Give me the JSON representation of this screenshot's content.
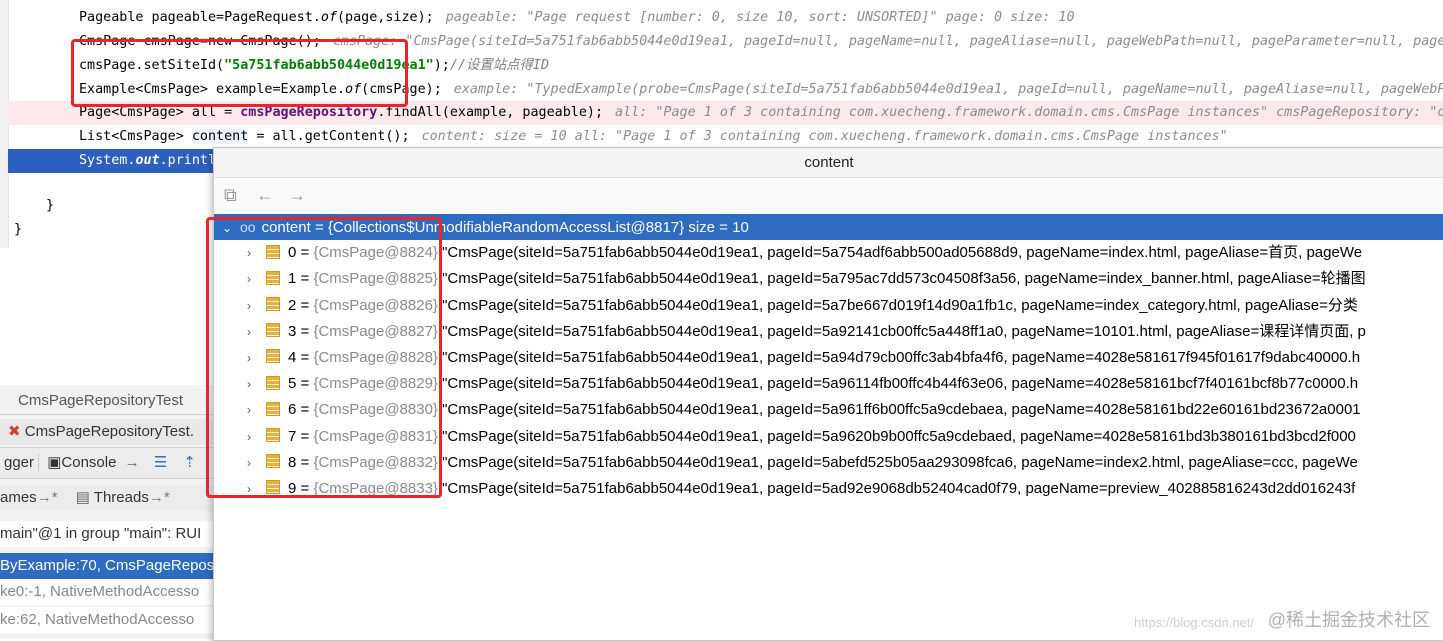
{
  "editor": {
    "line1_code": "Pageable pageable=PageRequest.",
    "line1_of": "of",
    "line1_rest": "(page,size);",
    "line1_hint": "pageable: \"Page request [number: 0, size 10, sort: UNSORTED]\"  page: 0  size: 10",
    "line2_code": "CmsPage cmsPage=new CmsPage();",
    "line2_hint": "cmsPage: \"CmsPage(siteId=5a751fab6abb5044e0d19ea1, pageId=null, pageName=null, pageAliase=null, pageWebPath=null, pageParameter=null, pageP",
    "line3_code": "cmsPage.setSiteId(",
    "line3_str": "\"5a751fab6abb5044e0d19ea1\"",
    "line3_rest": ");",
    "line3_comment": "//设置站点得ID",
    "line4_code": "Example<CmsPage> example=Example.",
    "line4_of": "of",
    "line4_rest": "(cmsPage);",
    "line4_hint": "example: \"TypedExample(probe=CmsPage(siteId=5a751fab6abb5044e0d19ea1, pageId=null, pageName=null, pageAliase=null, pageWebP",
    "line5_code": "Page<CmsPage> all = ",
    "line5_field": "cmsPageRepository",
    "line5_rest": ".findAll(example, pageable);",
    "line5_hint": "all: \"Page 1 of 3 containing com.xuecheng.framework.domain.cms.CmsPage instances\"  cmsPageRepository: \"o",
    "line6_code": "List<CmsPage> ",
    "line6_var": "content",
    "line6_rest": " = all.getContent();",
    "line6_hint": "content:  size = 10  all: \"Page 1 of 3 containing com.xuecheng.framework.domain.cms.CmsPage instances\"",
    "line7_code": "System.",
    "line7_out": "out",
    "line7_rest": ".printl",
    "brace1": "}",
    "brace2": "}"
  },
  "left_panel": {
    "tab1": "CmsPageRepositoryTest",
    "tab2": "CmsPageRepositoryTest.",
    "debugger_label": "gger",
    "console_label": "Console",
    "frames_label": "ames",
    "threads_label": "Threads",
    "thread_text": "main\"@1 in group \"main\": RUI",
    "frame1": "ByExample:70, CmsPageRepos",
    "frame2": "ke0:-1, NativeMethodAccesso",
    "frame3": "ke:62, NativeMethodAccesso"
  },
  "popup": {
    "title": "content",
    "root": {
      "name": "content",
      "value": "= {Collections$UnmodifiableRandomAccessList@8817}",
      "size": "size = 10"
    },
    "items": [
      {
        "index": "0",
        "ref": "{CmsPage@8824}",
        "value": "\"CmsPage(siteId=5a751fab6abb5044e0d19ea1, pageId=5a754adf6abb500ad05688d9, pageName=index.html, pageAliase=首页, pageWe"
      },
      {
        "index": "1",
        "ref": "{CmsPage@8825}",
        "value": "\"CmsPage(siteId=5a751fab6abb5044e0d19ea1, pageId=5a795ac7dd573c04508f3a56, pageName=index_banner.html, pageAliase=轮播图"
      },
      {
        "index": "2",
        "ref": "{CmsPage@8826}",
        "value": "\"CmsPage(siteId=5a751fab6abb5044e0d19ea1, pageId=5a7be667d019f14d90a1fb1c, pageName=index_category.html, pageAliase=分类"
      },
      {
        "index": "3",
        "ref": "{CmsPage@8827}",
        "value": "\"CmsPage(siteId=5a751fab6abb5044e0d19ea1, pageId=5a92141cb00ffc5a448ff1a0, pageName=10101.html, pageAliase=课程详情页面, p"
      },
      {
        "index": "4",
        "ref": "{CmsPage@8828}",
        "value": "\"CmsPage(siteId=5a751fab6abb5044e0d19ea1, pageId=5a94d79cb00ffc3ab4bfa4f6, pageName=4028e581617f945f01617f9dabc40000.h"
      },
      {
        "index": "5",
        "ref": "{CmsPage@8829}",
        "value": "\"CmsPage(siteId=5a751fab6abb5044e0d19ea1, pageId=5a96114fb00ffc4b44f63e06, pageName=4028e58161bcf7f40161bcf8b77c0000.h"
      },
      {
        "index": "6",
        "ref": "{CmsPage@8830}",
        "value": "\"CmsPage(siteId=5a751fab6abb5044e0d19ea1, pageId=5a961ff6b00ffc5a9cdebaea, pageName=4028e58161bd22e60161bd23672a0001"
      },
      {
        "index": "7",
        "ref": "{CmsPage@8831}",
        "value": "\"CmsPage(siteId=5a751fab6abb5044e0d19ea1, pageId=5a9620b9b00ffc5a9cdebaed, pageName=4028e58161bd3b380161bd3bcd2f000"
      },
      {
        "index": "8",
        "ref": "{CmsPage@8832}",
        "value": "\"CmsPage(siteId=5a751fab6abb5044e0d19ea1, pageId=5abefd525b05aa293098fca6, pageName=index2.html, pageAliase=ccc, pageWe"
      },
      {
        "index": "9",
        "ref": "{CmsPage@8833}",
        "value": "\"CmsPage(siteId=5a751fab6abb5044e0d19ea1, pageId=5ad92e9068db52404cad0f79, pageName=preview_402885816243d2dd016243f"
      }
    ]
  },
  "watermark": "@稀土掘金技术社区",
  "watermark_faint": "https://blog.csdn.net/"
}
